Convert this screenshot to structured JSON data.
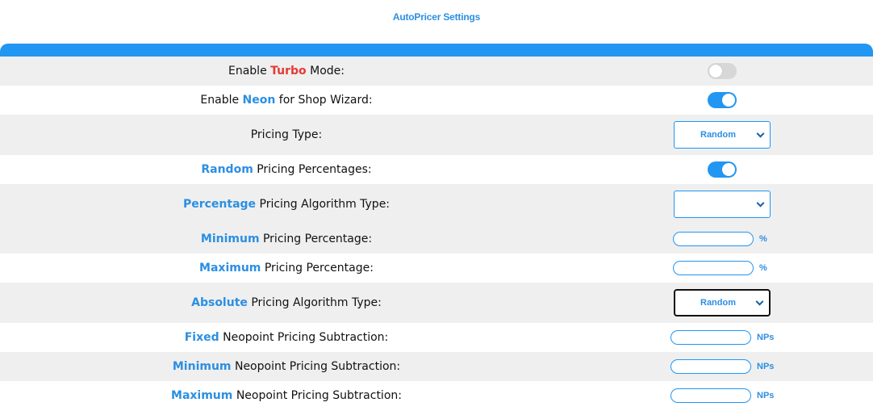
{
  "title": "AutoPricer Settings",
  "colors": {
    "accent": "#2196f3",
    "turbo": "#e53935"
  },
  "rows": [
    {
      "pre": "Enable ",
      "hl": "Turbo",
      "post": " Mode:",
      "control": "toggle",
      "state": "off"
    },
    {
      "pre": "Enable ",
      "hl": "Neon",
      "post": " for Shop Wizard:",
      "control": "toggle",
      "state": "on"
    },
    {
      "pre": "",
      "hl": "",
      "post": "Pricing Type:",
      "control": "select",
      "value": "Random"
    },
    {
      "pre": "",
      "hl": "Random",
      "post": " Pricing Percentages:",
      "control": "toggle",
      "state": "on"
    },
    {
      "pre": "",
      "hl": "Percentage",
      "post": " Pricing Algorithm Type:",
      "control": "select",
      "value": ""
    },
    {
      "pre": "",
      "hl": "Minimum",
      "post": " Pricing Percentage:",
      "control": "input",
      "value": "",
      "unit": "%"
    },
    {
      "pre": "",
      "hl": "Maximum",
      "post": " Pricing Percentage:",
      "control": "input",
      "value": "",
      "unit": "%"
    },
    {
      "pre": "",
      "hl": "Absolute",
      "post": " Pricing Algorithm Type:",
      "control": "select",
      "value": "Random"
    },
    {
      "pre": "",
      "hl": "Fixed",
      "post": " Neopoint Pricing Subtraction:",
      "control": "input",
      "value": "",
      "unit": "NPs"
    },
    {
      "pre": "",
      "hl": "Minimum",
      "post": " Neopoint Pricing Subtraction:",
      "control": "input",
      "value": "",
      "unit": "NPs"
    },
    {
      "pre": "",
      "hl": "Maximum",
      "post": " Neopoint Pricing Subtraction:",
      "control": "input",
      "value": "",
      "unit": "NPs"
    }
  ]
}
